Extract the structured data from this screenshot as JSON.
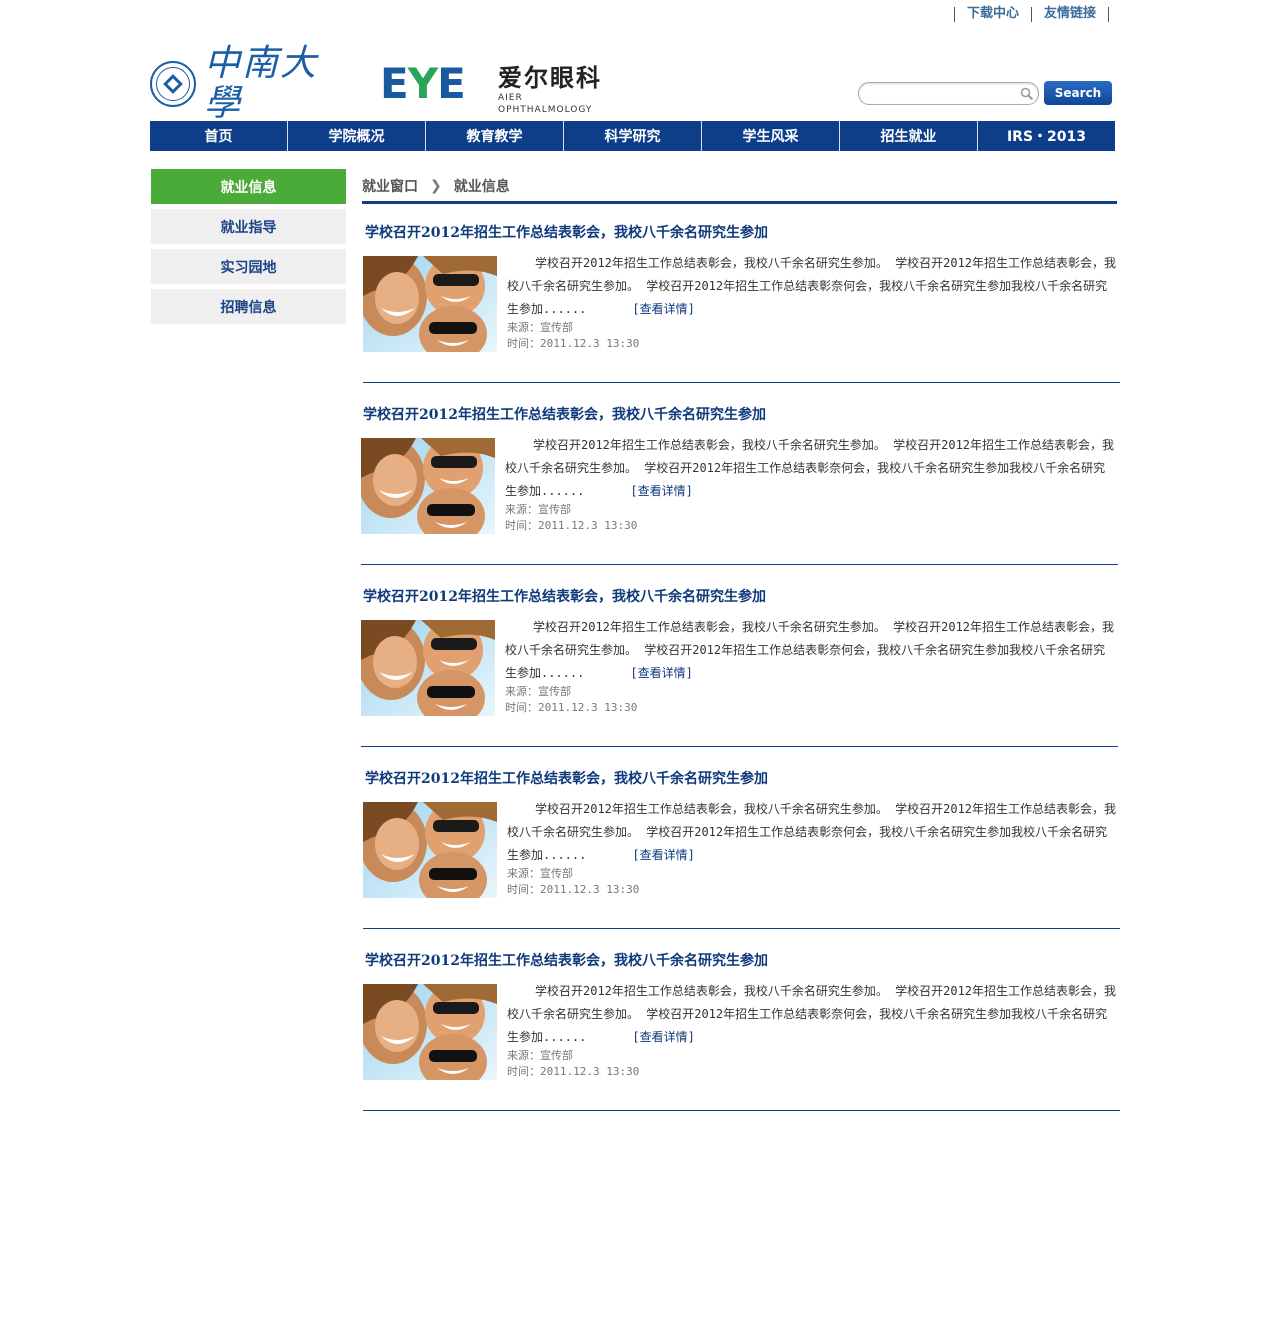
{
  "top_links": [
    "下载中心",
    "友情链接"
  ],
  "logos": {
    "csu_text": "中南大學",
    "eye_mark": "EYE",
    "eye_cn": "爱尔眼科",
    "eye_en": "AIER OPHTHALMOLOGY"
  },
  "search": {
    "placeholder": "",
    "button_label": "Search"
  },
  "nav": [
    "首页",
    "学院概况",
    "教育教学",
    "科学研究",
    "学生风采",
    "招生就业",
    "IRS・2013"
  ],
  "sidebar": {
    "items": [
      {
        "label": "就业信息",
        "active": true
      },
      {
        "label": "就业指导",
        "active": false
      },
      {
        "label": "实习园地",
        "active": false
      },
      {
        "label": "招聘信息",
        "active": false
      }
    ]
  },
  "breadcrumb": {
    "parent": "就业窗口",
    "current": "就业信息"
  },
  "articles": [
    {
      "title": "学校召开2012年招生工作总结表彰会，我校八千余名研究生参加",
      "summary": "学校召开2012年招生工作总结表彰会，我校八千余名研究生参加。 学校召开2012年招生工作总结表彰会，我校八千余名研究生参加。 学校召开2012年招生工作总结表彰奈何会，我校八千余名研究生参加我校八千余名研究生参加......",
      "more": "[查看详情]",
      "source": "来源：宣传部",
      "time": "时间：2011.12.3  13:30"
    },
    {
      "title": "学校召开2012年招生工作总结表彰会，我校八千余名研究生参加",
      "summary": "学校召开2012年招生工作总结表彰会，我校八千余名研究生参加。 学校召开2012年招生工作总结表彰会，我校八千余名研究生参加。 学校召开2012年招生工作总结表彰奈何会，我校八千余名研究生参加我校八千余名研究生参加......",
      "more": "[查看详情]",
      "source": "来源：宣传部",
      "time": "时间：2011.12.3  13:30"
    },
    {
      "title": "学校召开2012年招生工作总结表彰会，我校八千余名研究生参加",
      "summary": "学校召开2012年招生工作总结表彰会，我校八千余名研究生参加。 学校召开2012年招生工作总结表彰会，我校八千余名研究生参加。 学校召开2012年招生工作总结表彰奈何会，我校八千余名研究生参加我校八千余名研究生参加......",
      "more": "[查看详情]",
      "source": "来源：宣传部",
      "time": "时间：2011.12.3  13:30"
    },
    {
      "title": "学校召开2012年招生工作总结表彰会，我校八千余名研究生参加",
      "summary": "学校召开2012年招生工作总结表彰会，我校八千余名研究生参加。 学校召开2012年招生工作总结表彰会，我校八千余名研究生参加。 学校召开2012年招生工作总结表彰奈何会，我校八千余名研究生参加我校八千余名研究生参加......",
      "more": "[查看详情]",
      "source": "来源：宣传部",
      "time": "时间：2011.12.3  13:30"
    },
    {
      "title": "学校召开2012年招生工作总结表彰会，我校八千余名研究生参加",
      "summary": "学校召开2012年招生工作总结表彰会，我校八千余名研究生参加。 学校召开2012年招生工作总结表彰会，我校八千余名研究生参加。 学校召开2012年招生工作总结表彰奈何会，我校八千余名研究生参加我校八千余名研究生参加......",
      "more": "[查看详情]",
      "source": "来源：宣传部",
      "time": "时间：2011.12.3  13:30"
    }
  ],
  "colors": {
    "nav_bg": "#0e3d8a",
    "sidebar_active": "#4aab39",
    "sidebar_bg": "#efefef",
    "title_color": "#0e3a7c"
  }
}
